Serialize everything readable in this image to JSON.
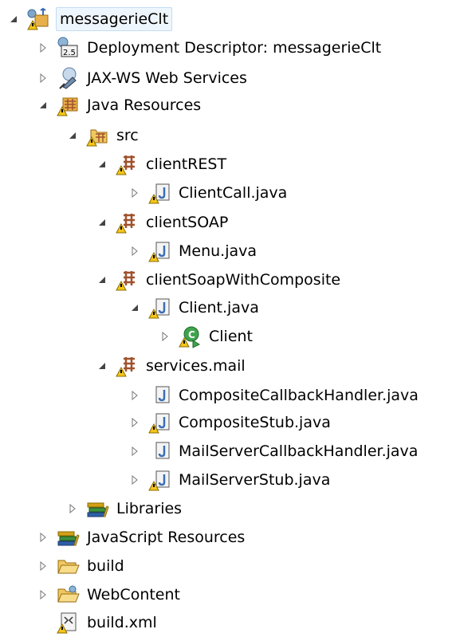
{
  "tree": {
    "project": "messagerieClt",
    "deployment_descriptor": "Deployment Descriptor: messagerieClt",
    "dd_badge": "2.5",
    "jaxws": "JAX-WS Web Services",
    "java_resources": "Java Resources",
    "src": "src",
    "client_rest": "clientREST",
    "client_call_java": "ClientCall.java",
    "client_soap": "clientSOAP",
    "menu_java": "Menu.java",
    "client_soap_composite": "clientSoapWithComposite",
    "client_java": "Client.java",
    "client_class": "Client",
    "services_mail": "services.mail",
    "composite_callback_java": "CompositeCallbackHandler.java",
    "composite_stub_java": "CompositeStub.java",
    "mailserver_callback_java": "MailServerCallbackHandler.java",
    "mailserver_stub_java": "MailServerStub.java",
    "libraries": "Libraries",
    "javascript_resources": "JavaScript Resources",
    "build": "build",
    "webcontent": "WebContent",
    "build_xml": "build.xml"
  },
  "colors": {
    "selection_bg": "#eef6fd",
    "selection_border": "#c2dcf3",
    "package": "#a0522d",
    "java_file": "#3b6db5",
    "warning": "#f5c518"
  }
}
